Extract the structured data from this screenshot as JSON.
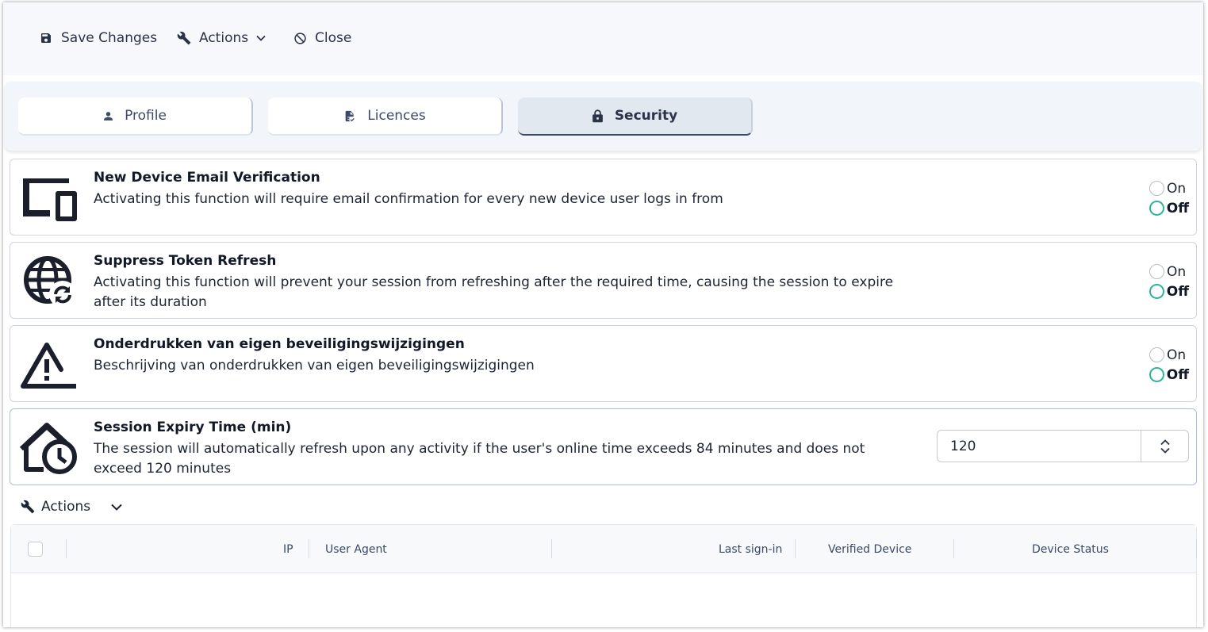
{
  "toolbar": {
    "save_label": "Save Changes",
    "actions_label": "Actions",
    "close_label": "Close"
  },
  "tabs": [
    {
      "label": "Profile",
      "icon": "person-icon"
    },
    {
      "label": "Licences",
      "icon": "document-check-icon"
    },
    {
      "label": "Security",
      "icon": "lock-icon",
      "active": true
    }
  ],
  "settings": [
    {
      "title": "New Device Email Verification",
      "description": "Activating this function will require email confirmation for every new device user logs in from",
      "icon": "devices-icon",
      "on_label": "On",
      "off_label": "Off",
      "selected": "Off"
    },
    {
      "title": "Suppress Token Refresh",
      "description": "Activating this function will prevent your session from refreshing after the required time, causing the session to expire after its duration",
      "icon": "globe-refresh-icon",
      "on_label": "On",
      "off_label": "Off",
      "selected": "Off"
    },
    {
      "title": "Onderdrukken van eigen beveiligingswijzigingen",
      "description": "Beschrijving van onderdrukken van eigen beveiligingswijzigingen",
      "icon": "warning-minus-icon",
      "on_label": "On",
      "off_label": "Off",
      "selected": "Off"
    },
    {
      "title": "Session Expiry Time (min)",
      "description": "The session will automatically refresh upon any activity if the user's online time exceeds 84 minutes and does not exceed 120 minutes",
      "icon": "home-clock-icon",
      "value": "120"
    }
  ],
  "device_actions": {
    "label": "Actions"
  },
  "table": {
    "columns": [
      "IP",
      "User Agent",
      "Last sign-in",
      "Verified Device",
      "Device Status"
    ],
    "rows": []
  },
  "colors": {
    "accent": "#2bb59a",
    "tab_active_border": "#3a4a68",
    "text": "#1d2433"
  }
}
